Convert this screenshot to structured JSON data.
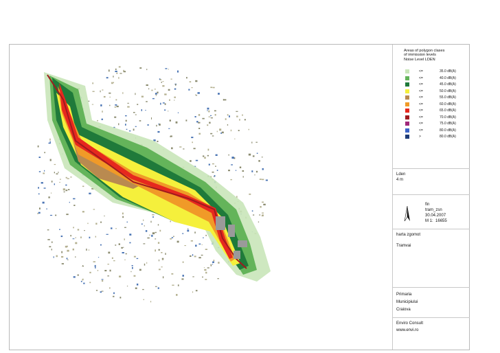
{
  "legend": {
    "title_line1": "Areas of polygon clases",
    "title_line2": "of immission levels",
    "title_line3": "Noise Level LDEN",
    "items": [
      {
        "op": "<=",
        "value": "35.0 dB(A)",
        "color": "#c9e6b9"
      },
      {
        "op": "<=",
        "value": "40.0 dB(A)",
        "color": "#64b45a"
      },
      {
        "op": "<=",
        "value": "45.0 dB(A)",
        "color": "#1f7a3a"
      },
      {
        "op": "<=",
        "value": "50.0 dB(A)",
        "color": "#f5f03c"
      },
      {
        "op": "<=",
        "value": "55.0 dB(A)",
        "color": "#b98a50"
      },
      {
        "op": "<=",
        "value": "60.0 dB(A)",
        "color": "#f09a28"
      },
      {
        "op": "<=",
        "value": "65.0 dB(A)",
        "color": "#e6281e"
      },
      {
        "op": "<=",
        "value": "70.0 dB(A)",
        "color": "#a01a1e"
      },
      {
        "op": "<=",
        "value": "75.0 dB(A)",
        "color": "#a0287a"
      },
      {
        "op": "<=",
        "value": "80.0 dB(A)",
        "color": "#3c64c8"
      },
      {
        "op": ">",
        "value": "80.0 dB(A)",
        "color": "#1e3c78"
      }
    ]
  },
  "params": {
    "indicator": "Lden",
    "height": "4 m"
  },
  "fileinfo": {
    "line1": "fin",
    "line2": "tram_zsn",
    "date": "30.04.2007",
    "scale_prefix": "M  1:",
    "scale_value": "16655"
  },
  "map_title": {
    "line1": "harta zgomot",
    "line2": "Tramvai"
  },
  "client": {
    "line1": "Primaria",
    "line2": "Municipiului",
    "line3": "Craiova"
  },
  "author": {
    "line1": "Enviro Consult",
    "line2": "www.envi.ro"
  }
}
